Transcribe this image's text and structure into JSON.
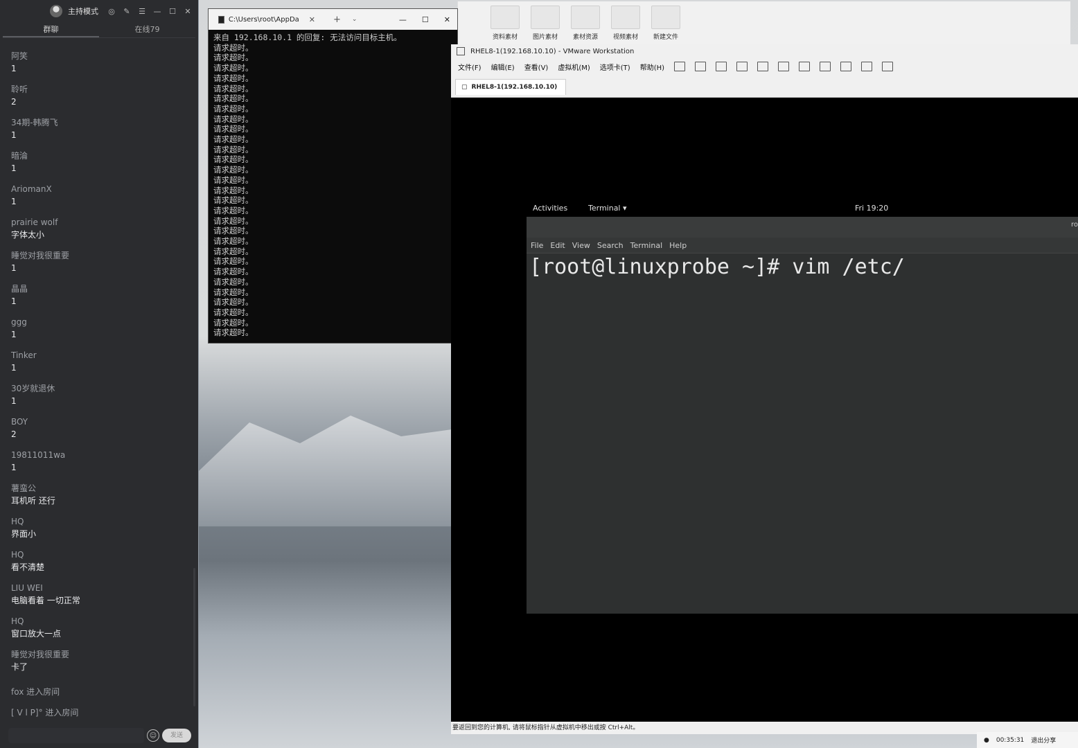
{
  "chat": {
    "mode_label": "主持模式",
    "tabs": [
      "群聊",
      "在线79"
    ],
    "messages": [
      {
        "name": "阿笑",
        "text": "1"
      },
      {
        "name": "聆听",
        "text": "2"
      },
      {
        "name": "34期-韩腾飞",
        "text": "1"
      },
      {
        "name": "暗淪",
        "text": "1"
      },
      {
        "name": "AriomanX",
        "text": "1"
      },
      {
        "name": "prairie wolf",
        "text": "字体太小"
      },
      {
        "name": "睡觉对我很重要",
        "text": "1"
      },
      {
        "name": "晶晶",
        "text": "1"
      },
      {
        "name": "ggg",
        "text": "1"
      },
      {
        "name": "Tinker",
        "text": "1"
      },
      {
        "name": "30岁就退休",
        "text": "1"
      },
      {
        "name": "BOY",
        "text": "2"
      },
      {
        "name": "19811011wa",
        "text": "1"
      },
      {
        "name": "薯蛮公",
        "text": "耳机听 还行"
      },
      {
        "name": "HQ",
        "text": "界面小"
      },
      {
        "name": "HQ",
        "text": "看不清楚"
      },
      {
        "name": "LIU WEI",
        "text": "电脑看着 一切正常"
      },
      {
        "name": "HQ",
        "text": "窗口放大一点"
      },
      {
        "name": "睡觉对我很重要",
        "text": "卡了"
      }
    ],
    "system_1": "fox 进入房间",
    "system_2": "[ V l P]° 进入房间",
    "send_label": "发送"
  },
  "explorer": {
    "folders": [
      "资料素材",
      "图片素材",
      "素材资源",
      "视频素材",
      "新建文件"
    ]
  },
  "cmd": {
    "tab_title": "C:\\Users\\root\\AppDa",
    "lines": [
      "来自 192.168.10.1 的回复: 无法访问目标主机。",
      "请求超时。",
      "请求超时。",
      "请求超时。",
      "请求超时。",
      "请求超时。",
      "请求超时。",
      "请求超时。",
      "请求超时。",
      "请求超时。",
      "请求超时。",
      "请求超时。",
      "请求超时。",
      "请求超时。",
      "请求超时。",
      "请求超时。",
      "请求超时。",
      "请求超时。",
      "请求超时。",
      "请求超时。",
      "请求超时。",
      "请求超时。",
      "请求超时。",
      "请求超时。",
      "请求超时。",
      "请求超时。",
      "请求超时。",
      "请求超时。",
      "请求超时。",
      "请求超时。"
    ]
  },
  "vmware": {
    "title": "RHEL8-1(192.168.10.10) - VMware Workstation",
    "menu": [
      "文件(F)",
      "编辑(E)",
      "查看(V)",
      "虚拟机(M)",
      "选项卡(T)",
      "帮助(H)"
    ],
    "tab_label": "RHEL8-1(192.168.10.10)",
    "status_hint": "要返回到您的计算机, 请将鼠标指针从虚拟机中移出或按 Ctrl+Alt。"
  },
  "gnome": {
    "activities": "Activities",
    "app_menu": "Terminal ▾",
    "clock": "Fri 19:20"
  },
  "terminal": {
    "menu": [
      "File",
      "Edit",
      "View",
      "Search",
      "Terminal",
      "Help"
    ],
    "command_line": "[root@linuxprobe ~]# vim /etc/",
    "title_fragment": "ro"
  },
  "share": {
    "timer": "00:35:31",
    "exit_label": "退出分享"
  }
}
